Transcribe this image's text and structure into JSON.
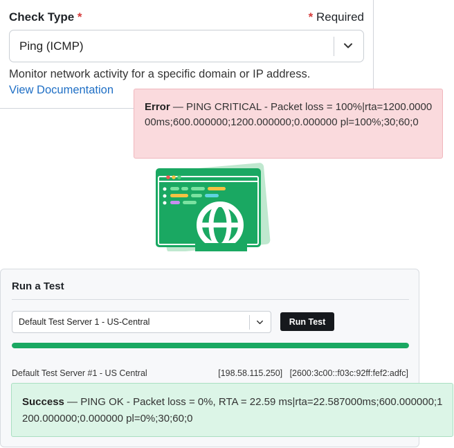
{
  "check_type": {
    "label": "Check Type",
    "required_star": "*",
    "required_label": "Required",
    "selected": "Ping (ICMP)",
    "help_text": "Monitor network activity for a specific domain or IP address.",
    "doc_link": "View Documentation"
  },
  "error": {
    "title": "Error",
    "separator": " — ",
    "message": "PING CRITICAL - Packet loss = 100%|rta=1200.000000ms;600.000000;1200.000000;0.000000 pl=100%;30;60;0"
  },
  "run_test": {
    "title": "Run a Test",
    "server_select": "Default Test Server 1 - US-Central",
    "run_button": "Run Test",
    "progress_percent": 100,
    "server_name": "Default Test Server #1 - US Central",
    "server_addresses": "[198.58.115.250]   [2600:3c00::f03c:92ff:fef2:adfc]"
  },
  "success": {
    "title": "Success",
    "separator": " — ",
    "message": "PING OK - Packet loss = 0%, RTA = 22.59 ms|rta=22.587000ms;600.000000;1200.000000;0.000000 pl=0%;30;60;0"
  },
  "colors": {
    "accent_green": "#1aa862",
    "error_bg": "#fadadd",
    "success_bg": "#dcf5e7",
    "link_blue": "#1f6fc5",
    "required_red": "#d63b3b"
  }
}
